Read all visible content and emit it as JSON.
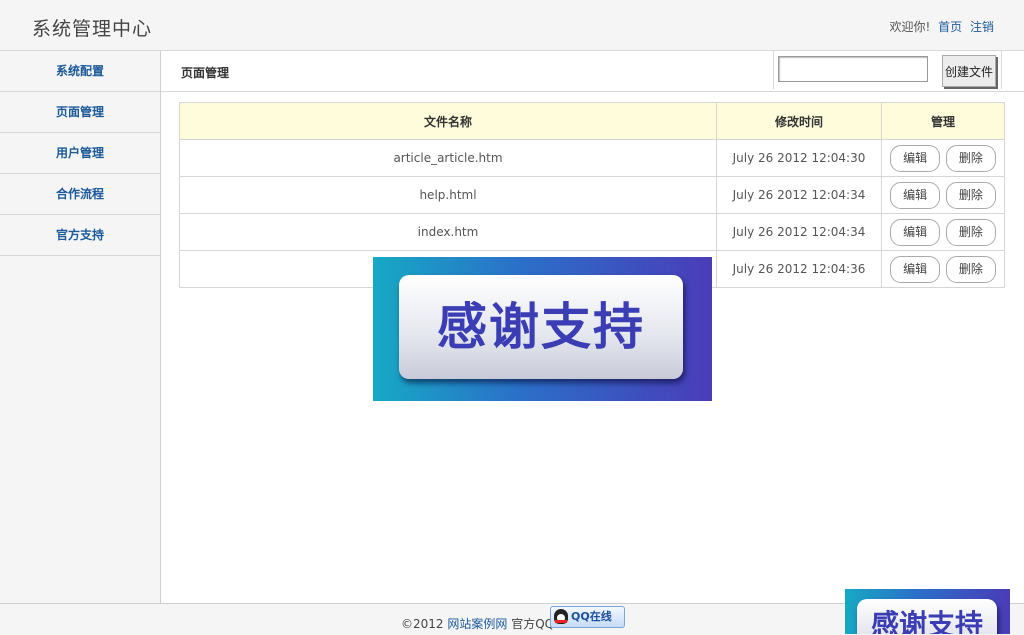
{
  "header": {
    "title": "系统管理中心",
    "welcome": "欢迎你!",
    "links": {
      "home": "首页",
      "logout": "注销"
    }
  },
  "sidebar": {
    "items": [
      {
        "label": "系统配置"
      },
      {
        "label": "页面管理"
      },
      {
        "label": "用户管理"
      },
      {
        "label": "合作流程"
      },
      {
        "label": "官方支持"
      }
    ]
  },
  "toolbar": {
    "title": "页面管理",
    "search_value": "",
    "create_label": "创建文件"
  },
  "table": {
    "headers": {
      "name": "文件名称",
      "time": "修改时间",
      "manage": "管理"
    },
    "edit_label": "编辑",
    "delete_label": "删除",
    "rows": [
      {
        "name": "article_article.htm",
        "time": "July 26 2012 12:04:30"
      },
      {
        "name": "help.html",
        "time": "July 26 2012 12:04:34"
      },
      {
        "name": "index.htm",
        "time": "July 26 2012 12:04:34"
      },
      {
        "name": "",
        "time": "July 26 2012 12:04:36"
      }
    ]
  },
  "overlay": {
    "text": "感谢支持"
  },
  "footer": {
    "copyright": "©2012",
    "site_link": "网站案例网",
    "qq_prefix": "官方QQ",
    "qq_badge": "QQ在线"
  }
}
